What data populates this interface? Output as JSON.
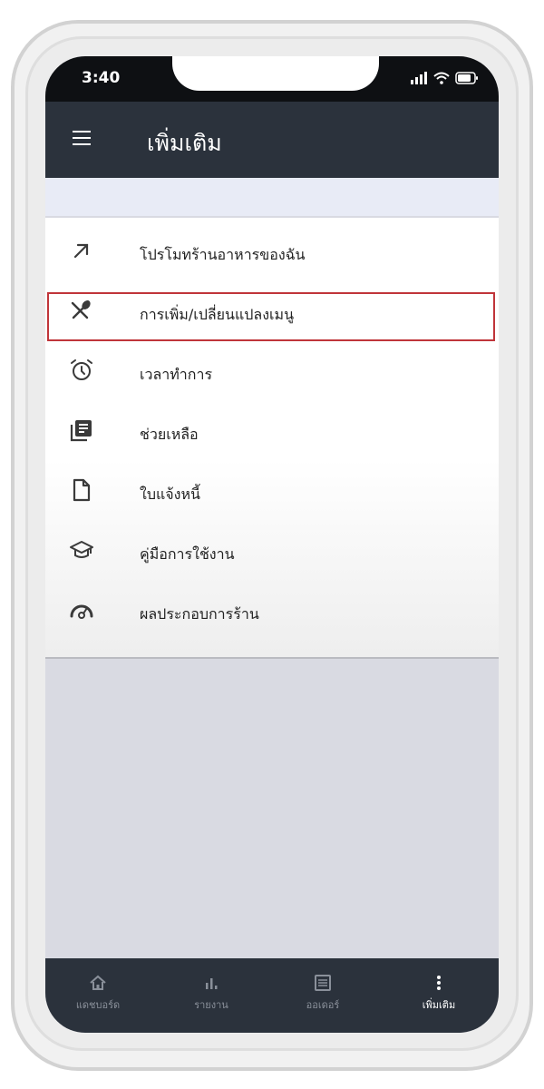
{
  "status_bar": {
    "time": "3:40"
  },
  "header": {
    "title": "เพิ่มเติม"
  },
  "menu": {
    "items": [
      {
        "label": "โปรโมทร้านอาหารของฉัน",
        "icon": "arrow-up-right-icon"
      },
      {
        "label": "การเพิ่ม/เปลี่ยนแปลงเมนู",
        "icon": "utensils-icon"
      },
      {
        "label": "เวลาทำการ",
        "icon": "alarm-clock-icon"
      },
      {
        "label": "ช่วยเหลือ",
        "icon": "notebook-icon"
      },
      {
        "label": "ใบแจ้งหนี้",
        "icon": "document-icon"
      },
      {
        "label": "คู่มือการใช้งาน",
        "icon": "graduation-cap-icon"
      },
      {
        "label": "ผลประกอบการร้าน",
        "icon": "speedometer-icon"
      }
    ],
    "highlighted_index": 1
  },
  "bottom_nav": {
    "items": [
      {
        "label": "แดชบอร์ด",
        "icon": "home-icon"
      },
      {
        "label": "รายงาน",
        "icon": "bar-chart-icon"
      },
      {
        "label": "ออเดอร์",
        "icon": "list-icon"
      },
      {
        "label": "เพิ่มเติม",
        "icon": "more-vertical-icon"
      }
    ],
    "active_index": 3
  },
  "colors": {
    "header_bg": "#2b323c",
    "highlight_border": "#c0353a",
    "status_bar_bg": "#0e1013",
    "content_bg": "#d9dae2"
  }
}
